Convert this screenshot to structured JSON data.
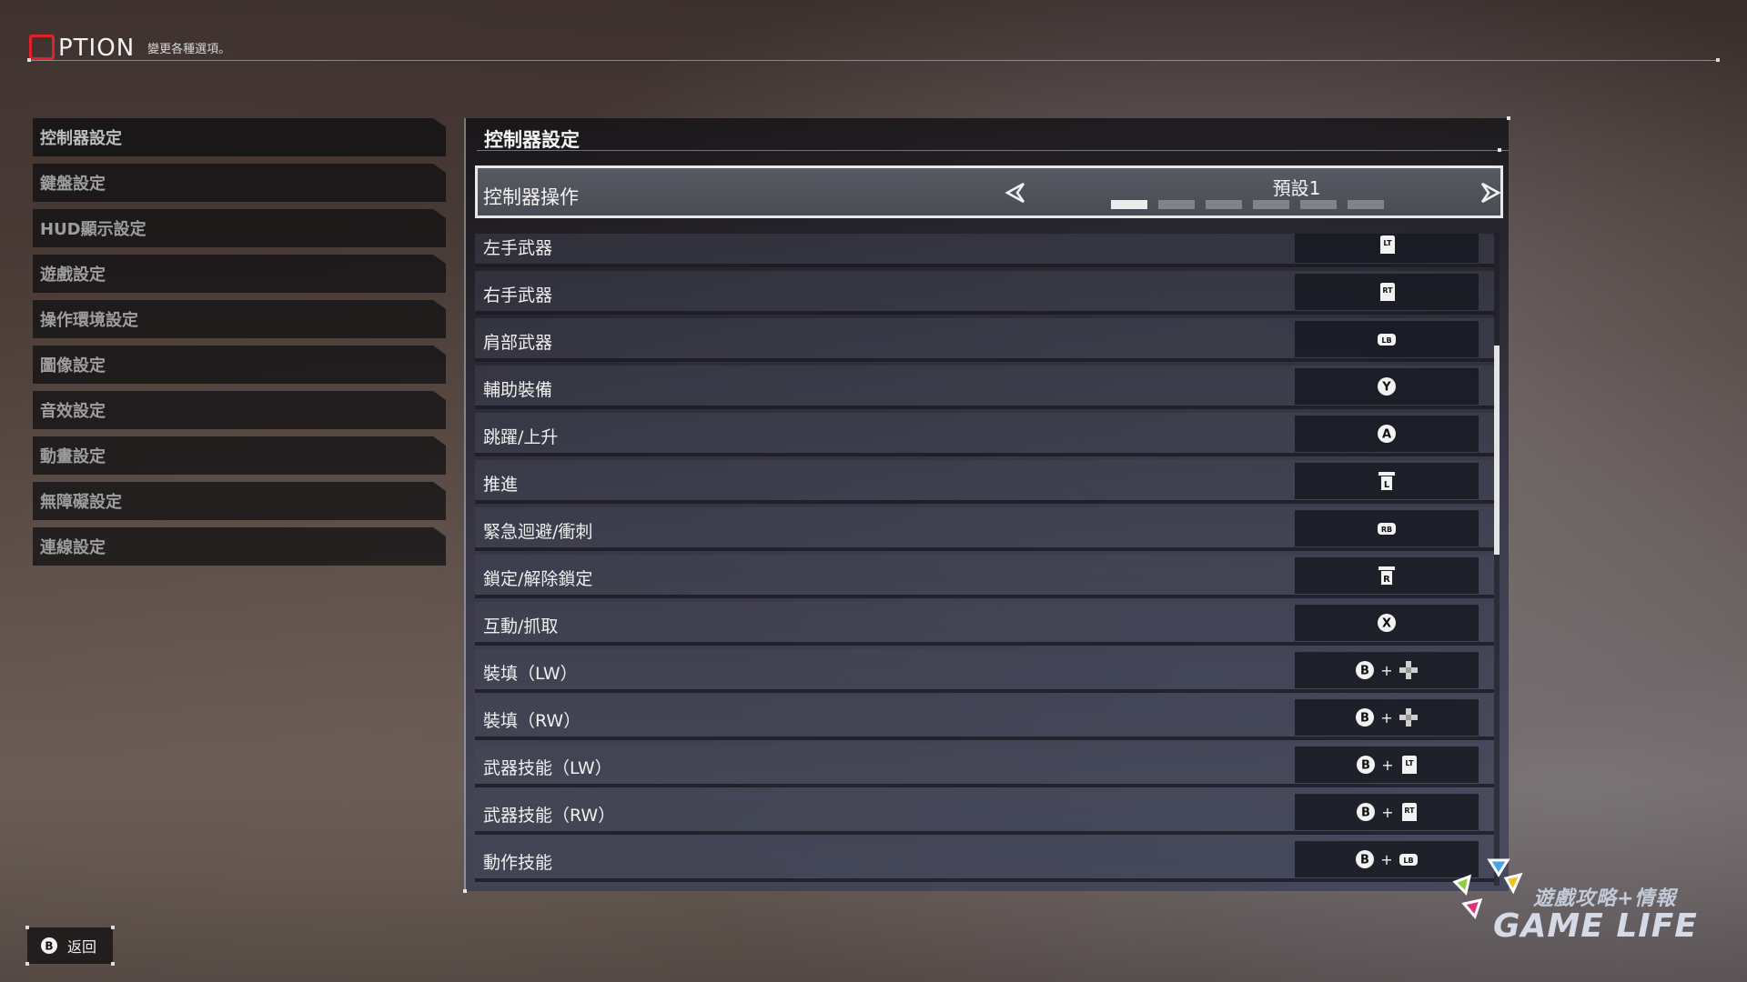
{
  "header": {
    "logo_text": "PTION",
    "subtitle": "變更各種選項。"
  },
  "sidebar": {
    "items": [
      {
        "label": "控制器設定"
      },
      {
        "label": "鍵盤設定"
      },
      {
        "label": "HUD顯示設定"
      },
      {
        "label": "遊戲設定"
      },
      {
        "label": "操作環境設定"
      },
      {
        "label": "圖像設定"
      },
      {
        "label": "音效設定"
      },
      {
        "label": "動畫設定"
      },
      {
        "label": "無障礙設定"
      },
      {
        "label": "連線設定"
      }
    ]
  },
  "panel": {
    "title": "控制器設定",
    "preset": {
      "label": "控制器操作",
      "value": "預設1",
      "pages_total": 6,
      "current_page": 1
    },
    "rows": [
      {
        "label": "左手武器",
        "keys": [
          "LT"
        ]
      },
      {
        "label": "右手武器",
        "keys": [
          "RT"
        ]
      },
      {
        "label": "肩部武器",
        "keys": [
          "LB"
        ]
      },
      {
        "label": "輔助裝備",
        "keys": [
          "Y"
        ]
      },
      {
        "label": "跳躍/上升",
        "keys": [
          "A"
        ]
      },
      {
        "label": "推進",
        "keys": [
          "L"
        ]
      },
      {
        "label": "緊急迴避/衝刺",
        "keys": [
          "RB"
        ]
      },
      {
        "label": "鎖定/解除鎖定",
        "keys": [
          "R"
        ]
      },
      {
        "label": "互動/抓取",
        "keys": [
          "X"
        ]
      },
      {
        "label": "裝填（LW）",
        "keys": [
          "B",
          "dpad"
        ]
      },
      {
        "label": "裝填（RW）",
        "keys": [
          "B",
          "dpad"
        ]
      },
      {
        "label": "武器技能（LW）",
        "keys": [
          "B",
          "LT"
        ]
      },
      {
        "label": "武器技能（RW）",
        "keys": [
          "B",
          "RT"
        ]
      },
      {
        "label": "動作技能",
        "keys": [
          "B",
          "LB"
        ]
      }
    ],
    "plus": "+"
  },
  "footer": {
    "back_button": "B",
    "back_label": "返回"
  },
  "watermark": {
    "line1": "遊戲攻略+情報",
    "line2": "GAME LIFE"
  },
  "colors": {
    "accent_red": "#e0202a",
    "panel_bg": "#14141a",
    "highlight_border": "#e9e9e9"
  }
}
